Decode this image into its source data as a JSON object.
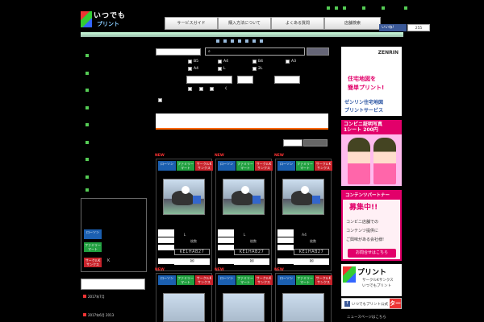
{
  "header": {
    "logo_line1": "いつでも",
    "logo_line2": "プリント",
    "nav": [
      "サービスガイド",
      "購入方法について",
      "よくある質問",
      "店舗検索"
    ],
    "like_label": "いいね!",
    "like_count": "255"
  },
  "sidebar": {
    "stores": [
      "ローソン",
      "ファミリーマート",
      "サークルK サンクス"
    ],
    "store_mark": "K",
    "links": [
      "2017年7月",
      "2017年6月 2013"
    ]
  },
  "search": {
    "placeholder": "",
    "sizes": [
      "B5",
      "A4",
      "B4",
      "A3",
      "A4",
      "L",
      "2L"
    ],
    "note": "く"
  },
  "cards": [
    {
      "new": "NEW",
      "stores": [
        "ローソン",
        "ファミリーマート",
        "サークルKサンクス"
      ],
      "size": "L",
      "caption": "枚数",
      "code": "KE1HAB27",
      "mail_icon": "mail-icon"
    },
    {
      "new": "NEW",
      "stores": [
        "ローソン",
        "ファミリーマート",
        "サークルKサンクス"
      ],
      "size": "L",
      "caption": "枚数",
      "code": "KE1HAB27",
      "mail_icon": "mail-icon"
    },
    {
      "new": "NEW",
      "stores": [
        "ローソン",
        "ファミリーマート",
        "サークルKサンクス"
      ],
      "size": "A4",
      "caption": "枚数",
      "code": "KE1HAB27",
      "mail_icon": "mail-icon"
    },
    {
      "new": "NEW",
      "stores": [
        "ローソン",
        "ファミリーマート",
        "サークルKサンクス"
      ]
    },
    {
      "new": "NEW",
      "stores": [
        "ローソン",
        "ファミリーマート",
        "サークルKサンクス"
      ]
    },
    {
      "new": "NEW",
      "stores": [
        "ローソン",
        "ファミリーマート",
        "サークルKサンクス"
      ]
    }
  ],
  "ads": {
    "zenrin": {
      "brand": "ZENRIN",
      "t1": "住宅地図を",
      "t2": "簡単プリント!",
      "t3": "ゼンリン住宅地図",
      "t4": "プリントサービス"
    },
    "photo": {
      "line1": "コンビニ証明写真",
      "line2": "1シート 200円"
    },
    "partner": {
      "hd1": "コンテンツパートナー",
      "hd2": "募集中!!",
      "b1": "コンビニ店舗での",
      "b2": "コンテンツ提供に",
      "b3": "ご興味がある会社様!",
      "btn": "お問合せはこちら"
    },
    "print": {
      "title": "プリント",
      "s1": "サークルKサンクス",
      "s2": "いつでもプリント"
    },
    "fb": {
      "text": "いつでもプリント公式",
      "red": "ター"
    }
  },
  "footer_note": "ニュースページはこちら"
}
